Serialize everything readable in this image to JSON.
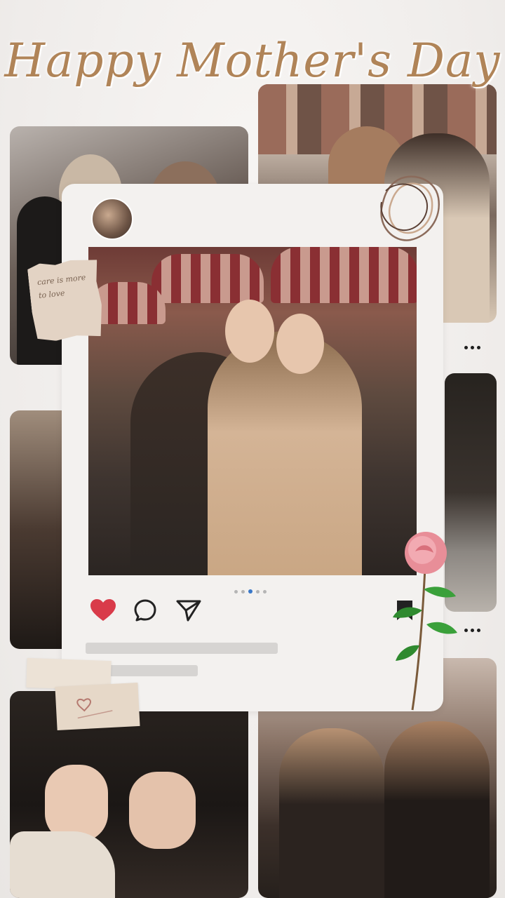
{
  "title": "Happy Mother's Day",
  "note_text": "care is more to love",
  "post": {
    "carousel_total": 5,
    "carousel_active": 3
  },
  "colors": {
    "accent_title": "#b08458",
    "like": "#d93b4a",
    "pager_active": "#3a78c9"
  },
  "icons": {
    "like": "heart-icon",
    "comment": "comment-icon",
    "share": "send-icon",
    "save": "bookmark-icon",
    "more": "more-icon"
  }
}
